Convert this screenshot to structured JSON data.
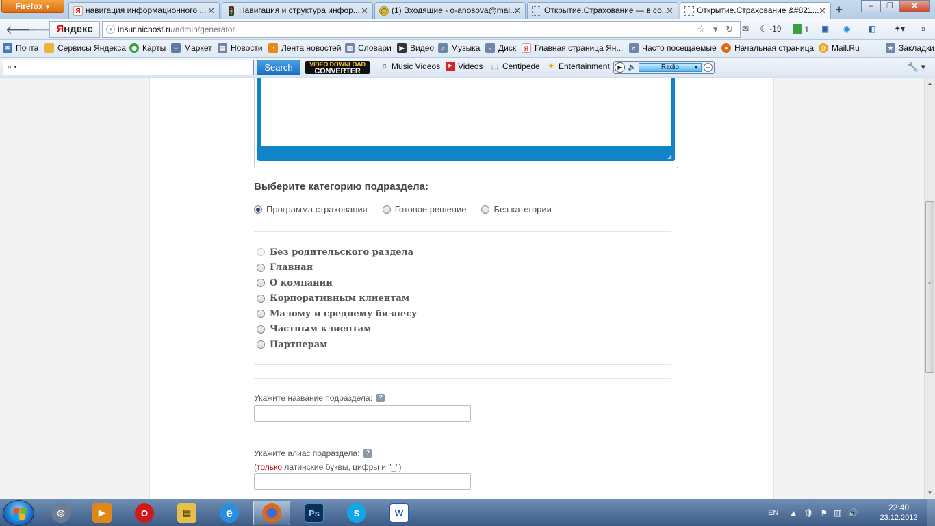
{
  "browser": {
    "menu_label": "Firefox",
    "tabs": [
      {
        "title": "навигация информационного ...",
        "favicon": "yandex-icon",
        "active": false
      },
      {
        "title": "Навигация и структура инфор...",
        "favicon": "traffic-light-icon",
        "active": false
      },
      {
        "title": "(1) Входящие - o-anosova@mai...",
        "favicon": "mail-icon",
        "active": false
      },
      {
        "title": "Открытие.Страхование — в со...",
        "favicon": "blank-page-icon",
        "active": false
      },
      {
        "title": "Открытие.Страхование &#821...",
        "favicon": "blank-page-icon",
        "active": true
      }
    ],
    "new_tab_label": "+",
    "window_buttons": {
      "minimize": "–",
      "maximize": "❐",
      "close": "✕"
    }
  },
  "navbar": {
    "yandex_label_first": "Я",
    "yandex_label_rest": "ндекс",
    "url_host": "insur.nichost.ru",
    "url_path": "/admin/generator",
    "url_right_glyphs": "☆ ▾ ↻",
    "weather": "-19",
    "counter": "1"
  },
  "bookmarks": [
    {
      "label": "Почта",
      "icon": "mail-icon",
      "color": "#4a78b8"
    },
    {
      "label": "Сервисы Яндекса",
      "icon": "folder-icon",
      "color": "#e8b73a"
    },
    {
      "label": "Карты",
      "icon": "map-icon",
      "color": "#3c9b3c"
    },
    {
      "label": "Маркет",
      "icon": "market-icon",
      "color": "#5d7aa7"
    },
    {
      "label": "Новости",
      "icon": "news-icon",
      "color": "#6f86a8"
    },
    {
      "label": "Лента новостей",
      "icon": "rss-icon",
      "color": "#e88a1a"
    },
    {
      "label": "Словари",
      "icon": "dictionary-icon",
      "color": "#6f86a8"
    },
    {
      "label": "Видео",
      "icon": "video-icon",
      "color": "#333333"
    },
    {
      "label": "Музыка",
      "icon": "music-icon",
      "color": "#6f86a8"
    },
    {
      "label": "Диск",
      "icon": "disk-icon",
      "color": "#6f86a8"
    },
    {
      "label": "Главная страница Ян...",
      "icon": "yandex-icon",
      "color": "#d02020"
    },
    {
      "label": "Часто посещаемые",
      "icon": "frequent-icon",
      "color": "#6f86a8"
    },
    {
      "label": "Начальная страница",
      "icon": "firefox-icon",
      "color": "#e06a12"
    },
    {
      "label": "Mail.Ru",
      "icon": "mailru-icon",
      "color": "#e8a21a"
    },
    {
      "label": "Закладки",
      "icon": "bookmarks-icon",
      "color": "#6f86a8"
    }
  ],
  "toolbar": {
    "search_placeholder": "",
    "search_button": "Search",
    "vdc_line1": "VIDEO DOWNLOAD",
    "vdc_line2": "CONVERTER",
    "items": [
      {
        "label": "Music Videos",
        "icon": "music-note-icon"
      },
      {
        "label": "Videos",
        "icon": "youtube-icon"
      },
      {
        "label": "Centipede",
        "icon": "centipede-icon"
      },
      {
        "label": "Entertainment",
        "icon": "star-icon"
      }
    ],
    "radio_label": "Radio"
  },
  "form": {
    "category_heading": "Выберите категорию подраздела:",
    "categories": [
      {
        "label": "Программа страхования",
        "checked": true
      },
      {
        "label": "Готовое решение",
        "checked": false
      },
      {
        "label": "Без категории",
        "checked": false
      }
    ],
    "parents": [
      {
        "label": "Без родительского раздела",
        "disabled": true
      },
      {
        "label": "Главная",
        "disabled": false
      },
      {
        "label": "О компании",
        "disabled": false
      },
      {
        "label": "Корпоративным клиентам",
        "disabled": false
      },
      {
        "label": "Малому и среднему бизнесу",
        "disabled": false
      },
      {
        "label": "Частным клиентам",
        "disabled": false
      },
      {
        "label": "Партнерам",
        "disabled": false
      }
    ],
    "name_label": "Укажите название подраздела:",
    "name_value": "",
    "alias_label": "Укажите алиас подраздела:",
    "alias_note_open": "(",
    "alias_note_red": "только",
    "alias_note_rest": " латинские буквы, цифры и \"_\")",
    "alias_value": "",
    "help_glyph": "?"
  },
  "taskbar": {
    "apps": [
      {
        "name": "network-app",
        "glyph": "◎",
        "color": "#6d7d8f"
      },
      {
        "name": "media-player-app",
        "glyph": "▶",
        "color": "#e0871a"
      },
      {
        "name": "opera-app",
        "glyph": "O",
        "color": "#d41818"
      },
      {
        "name": "explorer-app",
        "glyph": "▤",
        "color": "#e6c04a"
      },
      {
        "name": "ie-app",
        "glyph": "e",
        "color": "#2a8ee0"
      },
      {
        "name": "firefox-app",
        "glyph": "●",
        "color": "#e0661a"
      },
      {
        "name": "photoshop-app",
        "glyph": "Ps",
        "color": "#0d2f57"
      },
      {
        "name": "skype-app",
        "glyph": "S",
        "color": "#12a8e8"
      },
      {
        "name": "word-app",
        "glyph": "W",
        "color": "#1f5bb5"
      }
    ],
    "language": "EN",
    "time": "22:40",
    "date": "23.12.2012"
  }
}
